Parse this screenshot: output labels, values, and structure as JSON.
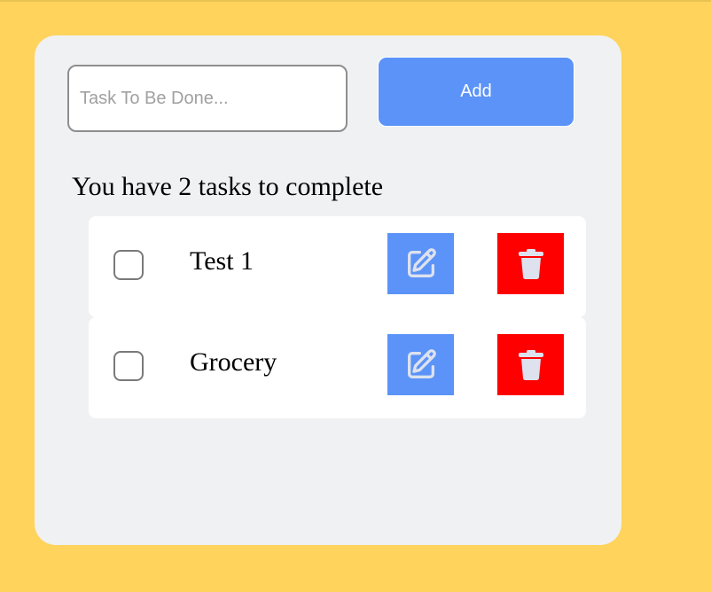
{
  "form": {
    "input_placeholder": "Task To Be Done...",
    "input_value": "",
    "add_label": "Add"
  },
  "summary": {
    "task_count_text": "You have 2 tasks to complete"
  },
  "tasks": [
    {
      "label": "Test 1",
      "checked": false,
      "edit_icon": "edit-icon",
      "delete_icon": "trash-icon"
    },
    {
      "label": "Grocery",
      "checked": false,
      "edit_icon": "edit-icon",
      "delete_icon": "trash-icon"
    }
  ],
  "colors": {
    "background": "#ffd35c",
    "card": "#f0f1f3",
    "primary": "#5b93f8",
    "danger": "#ff0000",
    "icon_fill": "#dde2ee"
  }
}
